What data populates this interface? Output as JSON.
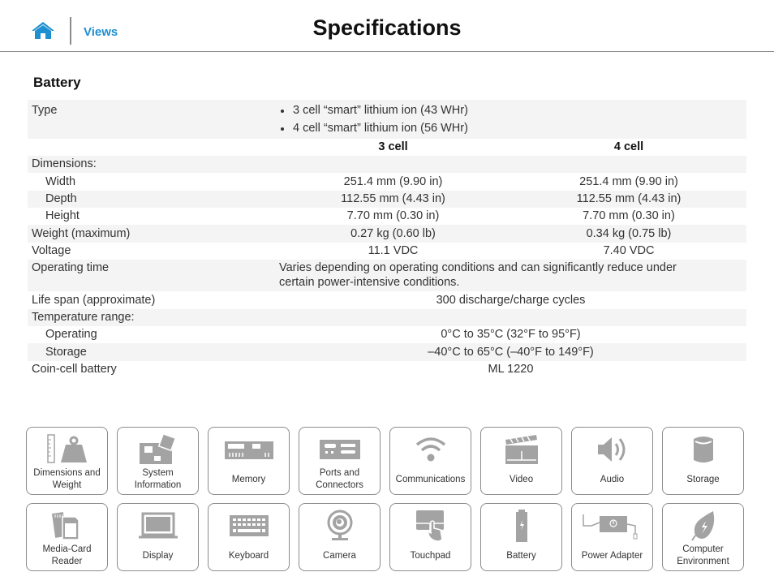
{
  "header": {
    "home_icon": "home-icon",
    "views_label": "Views",
    "title": "Specifications",
    "accent_color": "#1e8fd0"
  },
  "section": {
    "title": "Battery"
  },
  "spec": {
    "type_label": "Type",
    "type_values": [
      "3 cell “smart” lithium ion (43 WHr)",
      "4 cell “smart” lithium ion (56 WHr)"
    ],
    "columns": [
      "3 cell",
      "4 cell"
    ],
    "dimensions_label": "Dimensions:",
    "width": {
      "label": "Width",
      "values": [
        "251.4 mm (9.90 in)",
        "251.4 mm (9.90 in)"
      ]
    },
    "depth": {
      "label": "Depth",
      "values": [
        "112.55 mm (4.43 in)",
        "112.55 mm (4.43 in)"
      ]
    },
    "height": {
      "label": "Height",
      "values": [
        "7.70 mm (0.30 in)",
        "7.70 mm (0.30 in)"
      ]
    },
    "weight": {
      "label": "Weight (maximum)",
      "values": [
        "0.27 kg (0.60 lb)",
        "0.34 kg (0.75 lb)"
      ]
    },
    "voltage": {
      "label": "Voltage",
      "values": [
        "11.1 VDC",
        "7.40 VDC"
      ]
    },
    "operating_time": {
      "label": "Operating time",
      "value": "Varies depending on operating conditions and can significantly reduce under certain power-intensive conditions."
    },
    "life_span": {
      "label": "Life span (approximate)",
      "value": "300 discharge/charge cycles"
    },
    "temperature_label": "Temperature range:",
    "temp_operating": {
      "label": "Operating",
      "value": "0°C to 35°C (32°F to 95°F)"
    },
    "temp_storage": {
      "label": "Storage",
      "value": "–40°C to 65°C (–40°F to 149°F)"
    },
    "coin_cell": {
      "label": "Coin-cell battery",
      "value": "ML 1220"
    }
  },
  "tiles": [
    {
      "label": "Dimensions and Weight",
      "icon": "ruler-weight-icon"
    },
    {
      "label": "System Information",
      "icon": "motherboard-icon"
    },
    {
      "label": "Memory",
      "icon": "memory-module-icon"
    },
    {
      "label": "Ports and Connectors",
      "icon": "ports-icon"
    },
    {
      "label": "Communications",
      "icon": "wifi-icon"
    },
    {
      "label": "Video",
      "icon": "clapperboard-icon"
    },
    {
      "label": "Audio",
      "icon": "speaker-icon"
    },
    {
      "label": "Storage",
      "icon": "storage-cylinder-icon"
    },
    {
      "label": "Media-Card Reader",
      "icon": "sd-card-icon"
    },
    {
      "label": "Display",
      "icon": "laptop-display-icon"
    },
    {
      "label": "Keyboard",
      "icon": "keyboard-icon"
    },
    {
      "label": "Camera",
      "icon": "webcam-icon"
    },
    {
      "label": "Touchpad",
      "icon": "touchpad-icon"
    },
    {
      "label": "Battery",
      "icon": "battery-icon"
    },
    {
      "label": "Power Adapter",
      "icon": "power-adapter-icon"
    },
    {
      "label": "Computer Environment",
      "icon": "leaf-icon"
    }
  ]
}
